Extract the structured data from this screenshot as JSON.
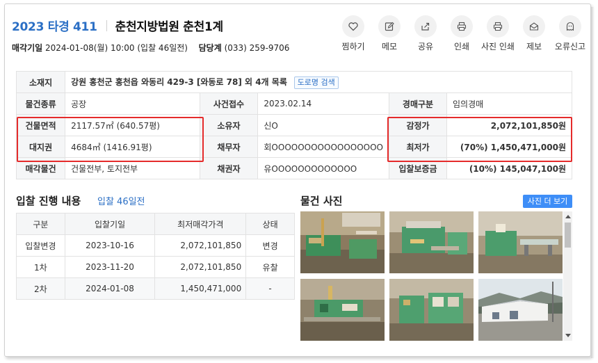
{
  "header": {
    "case_no": "2023 타경 411",
    "court": "춘천지방법원 춘천1계"
  },
  "subline": {
    "sale_date_label": "매각기일",
    "sale_date_value": "2024-01-08(월) 10:00 (입찰 46일전)",
    "contact_label": "담당계",
    "contact_value": "(033) 259-9706"
  },
  "actions": [
    {
      "label": "찜하기",
      "icon": "heart-icon"
    },
    {
      "label": "메모",
      "icon": "memo-icon"
    },
    {
      "label": "공유",
      "icon": "share-icon"
    },
    {
      "label": "인쇄",
      "icon": "print-icon"
    },
    {
      "label": "사진 인쇄",
      "icon": "photo-print-icon"
    },
    {
      "label": "제보",
      "icon": "report-mail-icon"
    },
    {
      "label": "오류신고",
      "icon": "ghost-icon"
    }
  ],
  "info": {
    "location_label": "소재지",
    "location_value": "강원 홍천군 홍천읍 와동리 429-3 [와동로 78] 외 4개 목록",
    "road_search": "도로명 검색",
    "type_label": "물건종류",
    "type_value": "공장",
    "received_label": "사건접수",
    "received_value": "2023.02.14",
    "auction_type_label": "경매구분",
    "auction_type_value": "임의경매",
    "building_area_label": "건물면적",
    "building_area_value": "2117.57㎡ (640.57평)",
    "owner_label": "소유자",
    "owner_value": "신O",
    "appraisal_label": "감정가",
    "appraisal_value": "2,072,101,850원",
    "land_right_label": "대지권",
    "land_right_value": "4684㎡ (1416.91평)",
    "debtor_label": "채무자",
    "debtor_value": "회OOOOOOOOOOOOOOOOO",
    "minimum_label": "최저가",
    "minimum_value": "(70%) 1,450,471,000원",
    "sale_item_label": "매각물건",
    "sale_item_value": "건물전부, 토지전부",
    "creditor_label": "채권자",
    "creditor_value": "유OOOOOOOOOOOOO",
    "deposit_label": "입찰보증금",
    "deposit_value": "(10%) 145,047,100원"
  },
  "bids": {
    "title": "입찰 진행 내용",
    "subtitle": "입찰 46일전",
    "headers": [
      "구분",
      "입찰기일",
      "최저매각가격",
      "상태"
    ],
    "rows": [
      [
        "입찰변경",
        "2023-10-16",
        "2,072,101,850",
        "변경"
      ],
      [
        "1차",
        "2023-11-20",
        "2,072,101,850",
        "유찰"
      ],
      [
        "2차",
        "2024-01-08",
        "1,450,471,000",
        "-"
      ]
    ]
  },
  "photos": {
    "title": "물건 사진",
    "more_button": "사진 더 보기"
  },
  "colors": {
    "accent": "#2b6fc5",
    "highlight": "#e52b2b",
    "button": "#3e8ef7"
  }
}
